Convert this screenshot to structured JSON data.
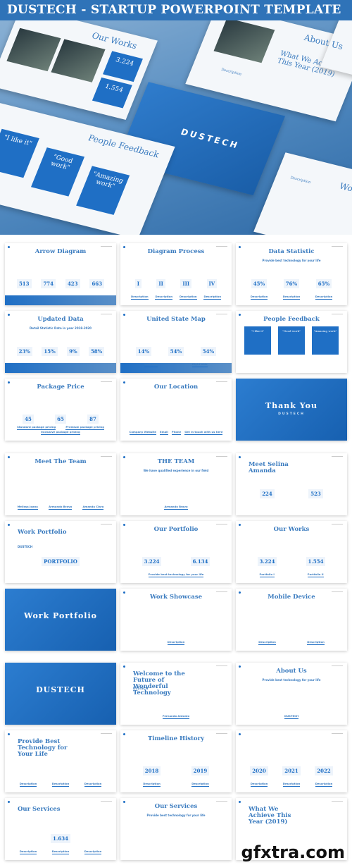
{
  "banner": {
    "title": "DUSTECH - STARTUP POWERPOINT TEMPLATE"
  },
  "hero": {
    "our_works": "Our Works",
    "stat_a": "3.224",
    "stat_b": "1.554",
    "achieve": "What We Achieve This Year (2019)",
    "about": "About Us",
    "brand": "DUSTECH",
    "feedback": "People Feedback",
    "quotes": [
      "\"I like it\"",
      "\"Good work\"",
      "\"Amazing work\""
    ],
    "showcase": "Work Sho",
    "description": "Description"
  },
  "colors": {
    "primary": "#1f6fc5",
    "title": "#3a7bbf"
  },
  "grid": {
    "slides": [
      {
        "title": "Arrow Diagram",
        "stats": [
          "513",
          "774",
          "423",
          "663"
        ],
        "bar": true
      },
      {
        "title": "Diagram Process",
        "stats": [
          "I",
          "II",
          "III",
          "IV"
        ],
        "labels": [
          "Description",
          "Description",
          "Description",
          "Description"
        ]
      },
      {
        "title": "Data Statistic",
        "subtitle": "Provide best technology for your life",
        "stats": [
          "45%",
          "76%",
          "65%"
        ],
        "labels": [
          "Description",
          "Description",
          "Description"
        ]
      },
      {
        "title": "Updated Data",
        "subtitle": "Detail Statistic Data in year 2018-2020",
        "stats": [
          "23%",
          "15%",
          "9%",
          "58%"
        ],
        "bar": true
      },
      {
        "title": "United State Map",
        "stats": [
          "14%",
          "54%",
          "54%"
        ],
        "labels": [
          "Left side",
          "Right side"
        ],
        "bar": true
      },
      {
        "title": "People Feedback",
        "quotes": [
          "\"I like it\"",
          "\"Good work\"",
          "\"Amazing work\""
        ]
      },
      {
        "title": "Package Price",
        "stats": [
          "45",
          "65",
          "87"
        ],
        "labels": [
          "Standard package pricing",
          "Premium package pricing",
          "Exclusive package pricing"
        ]
      },
      {
        "title": "Our Location",
        "labels": [
          "Company Website",
          "Email",
          "Phone",
          "Get in touch with us here"
        ]
      },
      {
        "title": "Thank You",
        "theme": "blue",
        "subtitle": "DUSTECH"
      },
      {
        "title": "Meet The Team",
        "labels": [
          "Melissa Joana",
          "Armando Bravo",
          "Amanda Clara"
        ]
      },
      {
        "title": "THE TEAM",
        "subtitle": "We have qualified experience in our field",
        "labels": [
          "Armando Bravo"
        ]
      },
      {
        "title": "Meet Selina Amanda",
        "align": "left",
        "stats": [
          "224",
          "523"
        ]
      },
      {
        "title": "Work Portfolio",
        "align": "left",
        "subtitle": "DUSTECH",
        "stats": [
          "PORTFOLIO"
        ]
      },
      {
        "title": "Our Portfolio",
        "stats": [
          "3.224",
          "6.134"
        ],
        "labels": [
          "Provide best technology for your life"
        ]
      },
      {
        "title": "Our Works",
        "stats": [
          "3.224",
          "1.554"
        ],
        "labels": [
          "Portfolio I",
          "Portfolio II"
        ]
      },
      {
        "title": "Work Portfolio",
        "theme": "blue"
      },
      {
        "title": "Work Showcase",
        "labels": [
          "Description"
        ]
      },
      {
        "title": "Mobile Device",
        "labels": [
          "Description",
          "Description"
        ]
      },
      {
        "title": "DUSTECH",
        "theme": "blue"
      },
      {
        "title": "Welcome to the Future of Wonderful Technology",
        "align": "left",
        "subtitle": "DUSTECH",
        "labels": [
          "Fernando Antonio"
        ]
      },
      {
        "title": "About Us",
        "subtitle": "Provide best technology for your life",
        "labels": [
          "DUSTECH"
        ]
      },
      {
        "title": "Provide Best Technology for Your Life",
        "align": "left",
        "labels": [
          "Description",
          "Description",
          "Description"
        ]
      },
      {
        "title": "Timeline History",
        "stats": [
          "2018",
          "2019"
        ],
        "labels": [
          "Description",
          "Description"
        ]
      },
      {
        "title": "",
        "stats": [
          "2020",
          "2021",
          "2022"
        ],
        "labels": [
          "Description",
          "Description",
          "Description"
        ]
      },
      {
        "title": "Our Services",
        "align": "left",
        "stats": [
          "1.634"
        ],
        "labels": [
          "Description",
          "Description",
          "Description"
        ]
      },
      {
        "title": "Our Services",
        "subtitle": "Provide best technology for your life"
      },
      {
        "title": "What We Achieve This Year (2019)",
        "align": "left"
      }
    ]
  },
  "watermark": "gfxtra.com"
}
